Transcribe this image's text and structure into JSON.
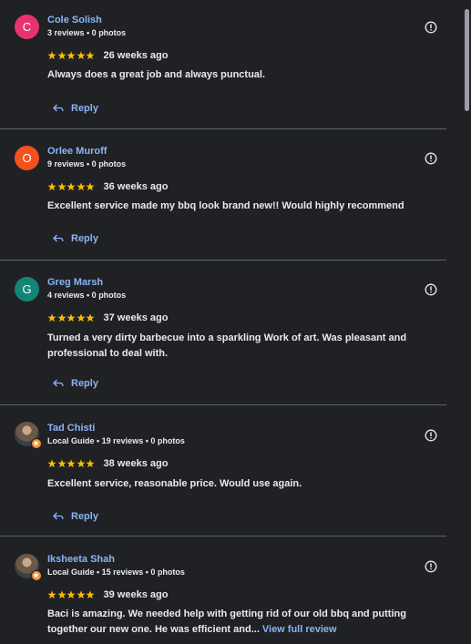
{
  "reviews": [
    {
      "initial": "C",
      "avatar_color": "#e8336f",
      "name": "Cole Solish",
      "meta": "3 reviews • 0 photos",
      "rating": 5,
      "time": "26 weeks ago",
      "text": "Always does a great job and always punctual.",
      "reply_label": "Reply"
    },
    {
      "initial": "O",
      "avatar_color": "#f4511e",
      "name": "Orlee Muroff",
      "meta": "9 reviews • 0 photos",
      "rating": 5,
      "time": "36 weeks ago",
      "text": "Excellent service made my bbq look brand new!! Would highly recommend",
      "reply_label": "Reply"
    },
    {
      "initial": "G",
      "avatar_color": "#138575",
      "name": "Greg Marsh",
      "meta": "4 reviews • 0 photos",
      "rating": 5,
      "time": "37 weeks ago",
      "text": "Turned a very dirty barbecue into a sparkling Work of art. Was pleasant and professional to deal with.",
      "reply_label": "Reply"
    },
    {
      "initial": "",
      "avatar_color": "",
      "name": "Tad Chisti",
      "meta": "Local Guide • 19 reviews • 0 photos",
      "rating": 5,
      "time": "38 weeks ago",
      "text": "Excellent service, reasonable price. Would use again.",
      "reply_label": "Reply"
    },
    {
      "initial": "",
      "avatar_color": "",
      "name": "Iksheeta Shah",
      "meta": "Local Guide • 15 reviews • 0 photos",
      "rating": 5,
      "time": "39 weeks ago",
      "text": "Baci is amazing. We needed help with getting rid of our old bbq and putting together our new one. He was efficient and...",
      "view_full_label": "View full review"
    }
  ],
  "colors": {
    "background": "#202124",
    "link": "#8ab4f8",
    "star": "#fbbc04",
    "divider": "#5f6368"
  }
}
